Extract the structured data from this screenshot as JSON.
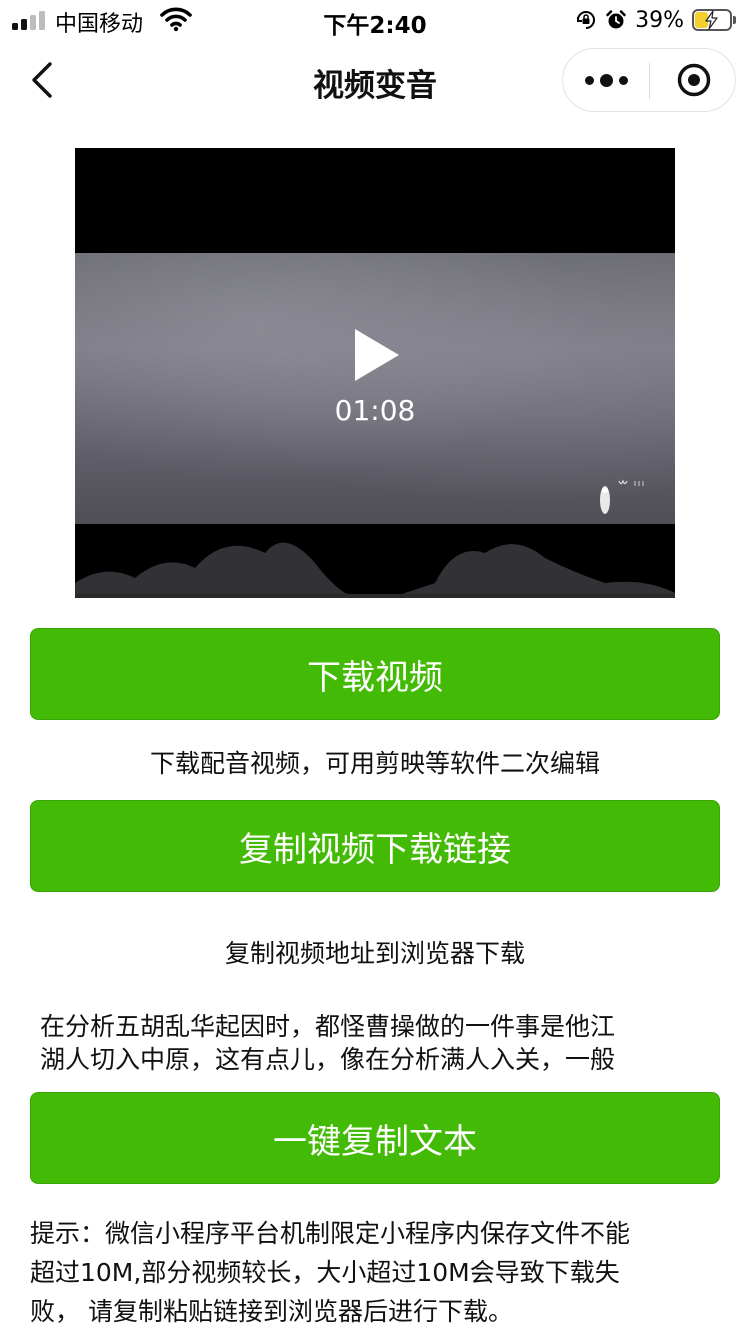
{
  "status_bar": {
    "carrier": "中国移动",
    "time": "下午2:40",
    "battery_percent": "39%",
    "battery_level": 0.39,
    "icons": [
      "signal-icon",
      "wifi-icon",
      "orientation-lock-icon",
      "alarm-icon",
      "battery-charging-icon"
    ]
  },
  "nav": {
    "title": "视频变音",
    "back_icon": "chevron-left-icon",
    "more_icon": "more-dots-icon",
    "close_icon": "target-close-icon"
  },
  "video": {
    "duration": "01:08",
    "play_icon": "play-icon"
  },
  "actions": {
    "download_label": "下载视频",
    "download_caption": "下载配音视频，可用剪映等软件二次编辑",
    "copy_link_label": "复制视频下载链接",
    "copy_link_caption": "复制视频地址到浏览器下载",
    "copy_text_label": "一键复制文本"
  },
  "transcript": {
    "lines": [
      "在分析五胡乱华起因时，都怪曹操做的一件事是他江",
      "湖人切入中原，这有点儿，像在分析满人入关，一般"
    ]
  },
  "tip": {
    "lines": [
      "提示：微信小程序平台机制限定小程序内保存文件不能",
      "超过10M,部分视频较长，大小超过10M会导致下载失",
      "败， 请复制粘贴链接到浏览器后进行下载。"
    ]
  },
  "colors": {
    "primary_green": "#43bb06",
    "battery_yellow": "#f5cf2b"
  }
}
